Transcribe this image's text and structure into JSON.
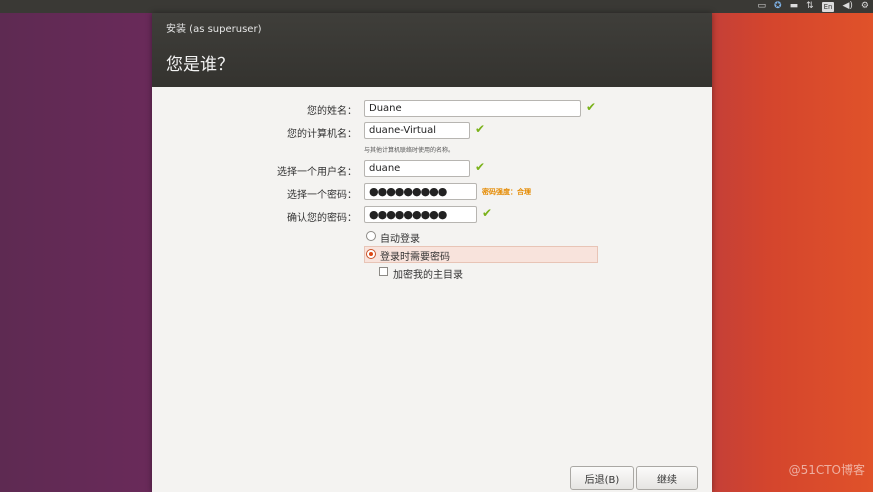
{
  "tray": {
    "keyboard_icon": "keyboard-icon",
    "accessibility_icon": "accessibility-icon",
    "battery_icon": "battery-icon",
    "network_icon": "network-arrows-icon",
    "lang_label": "En",
    "volume_icon": "volume-icon",
    "power_icon": "power-gear-icon"
  },
  "window": {
    "title": "安装 (as superuser)",
    "page_title": "您是谁？"
  },
  "form": {
    "name_label": "您的姓名：",
    "name_value": "Duane",
    "computer_label": "您的计算机名：",
    "computer_value": "duane-Virtual",
    "computer_hint": "与其他计算机联络时使用的名称。",
    "username_label": "选择一个用户名：",
    "username_value": "duane",
    "password_label": "选择一个密码：",
    "password_value": "●●●●●●●●●",
    "password_strength": "密码强度：合理",
    "confirm_label": "确认您的密码：",
    "confirm_value": "●●●●●●●●●",
    "check_mark": "✔",
    "auto_login_label": "自动登录",
    "require_password_label": "登录时需要密码",
    "encrypt_home_label": "加密我的主目录"
  },
  "buttons": {
    "back_label": "后退(B)",
    "continue_label": "继续"
  },
  "watermark": "@51CTO博客",
  "colors": {
    "accent": "#dd4814",
    "check": "#7ab21a",
    "strength": "#e58a00",
    "titlebar": "#3a3935"
  }
}
